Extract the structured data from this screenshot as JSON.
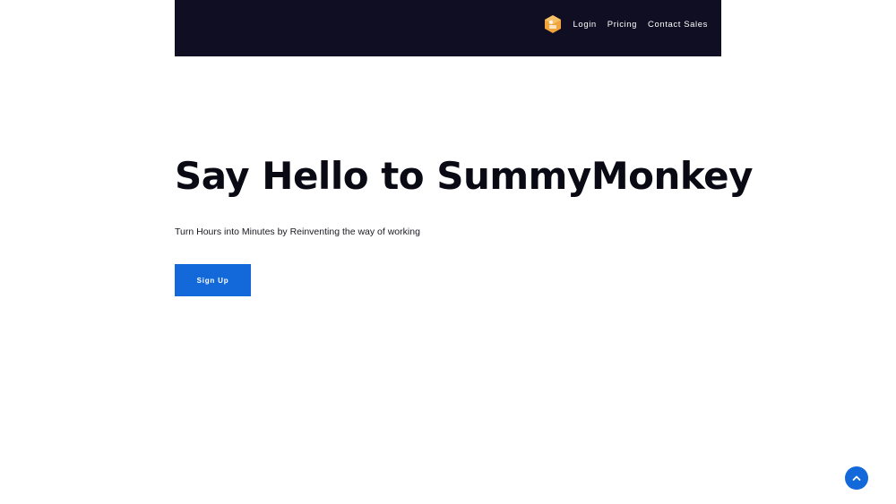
{
  "nav": {
    "logo_icon": "hexagon-logo-icon",
    "links": [
      {
        "label": "Login"
      },
      {
        "label": "Pricing"
      },
      {
        "label": "Contact Sales"
      }
    ]
  },
  "hero": {
    "title": "Say Hello to SummyMonkey",
    "subtitle": "Turn Hours into Minutes by Reinventing the way of working",
    "signup_label": "Sign Up"
  },
  "scroll_top": {
    "icon": "chevron-up-icon"
  },
  "colors": {
    "navbar_bg": "#0f0e22",
    "accent": "#1369d9",
    "logo_orange": "#f0a43a"
  }
}
